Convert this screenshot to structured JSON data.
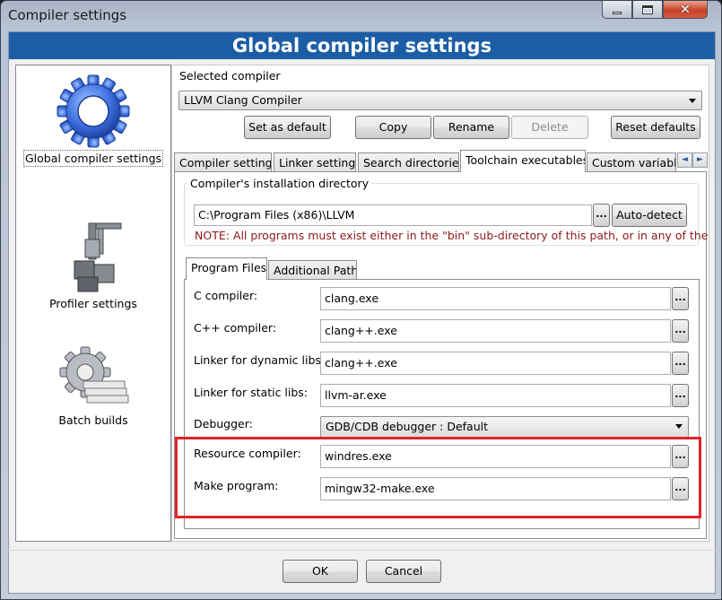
{
  "window": {
    "title": "Compiler settings",
    "minimize_icon": "minimize-icon",
    "maximize_icon": "maximize-icon",
    "close_icon": "close-icon",
    "close_glyph": "✕"
  },
  "banner": {
    "title": "Global compiler settings"
  },
  "sidebar": {
    "items": [
      {
        "label": "Global compiler settings",
        "icon": "gear-icon",
        "selected": true
      },
      {
        "label": "Profiler settings",
        "icon": "caliper-icon",
        "selected": false
      },
      {
        "label": "Batch builds",
        "icon": "batch-gear-icon",
        "selected": false
      }
    ]
  },
  "compiler_select": {
    "label": "Selected compiler",
    "value": "LLVM Clang Compiler"
  },
  "compiler_buttons": {
    "set_default": "Set as default",
    "copy": "Copy",
    "rename": "Rename",
    "delete": "Delete",
    "reset_defaults": "Reset defaults"
  },
  "tabs": [
    {
      "label": "Compiler settings",
      "active": false
    },
    {
      "label": "Linker settings",
      "active": false
    },
    {
      "label": "Search directories",
      "active": false
    },
    {
      "label": "Toolchain executables",
      "active": true
    },
    {
      "label": "Custom variables",
      "active": false
    }
  ],
  "tab_scroll": {
    "left": "◄",
    "right": "►"
  },
  "install_dir": {
    "group_title": "Compiler's installation directory",
    "value": "C:\\Program Files (x86)\\LLVM",
    "browse": "...",
    "auto_detect": "Auto-detect",
    "note": "NOTE: All programs must exist either in the \"bin\" sub-directory of this path, or in any of the"
  },
  "subtabs": [
    {
      "label": "Program Files",
      "active": true
    },
    {
      "label": "Additional Paths",
      "active": false
    }
  ],
  "programs": [
    {
      "label": "C compiler:",
      "value": "clang.exe",
      "browse": "..."
    },
    {
      "label": "C++ compiler:",
      "value": "clang++.exe",
      "browse": "..."
    },
    {
      "label": "Linker for dynamic libs:",
      "value": "clang++.exe",
      "browse": "..."
    },
    {
      "label": "Linker for static libs:",
      "value": "llvm-ar.exe",
      "browse": "..."
    }
  ],
  "debugger": {
    "label": "Debugger:",
    "value": "GDB/CDB debugger : Default"
  },
  "highlighted_programs": [
    {
      "label": "Resource compiler:",
      "value": "windres.exe",
      "browse": "..."
    },
    {
      "label": "Make program:",
      "value": "mingw32-make.exe",
      "browse": "..."
    }
  ],
  "highlight_color": "#e0242c",
  "banner_color": "#1c5ea5",
  "note_color": "#8b1a1a",
  "footer": {
    "ok": "OK",
    "cancel": "Cancel"
  }
}
